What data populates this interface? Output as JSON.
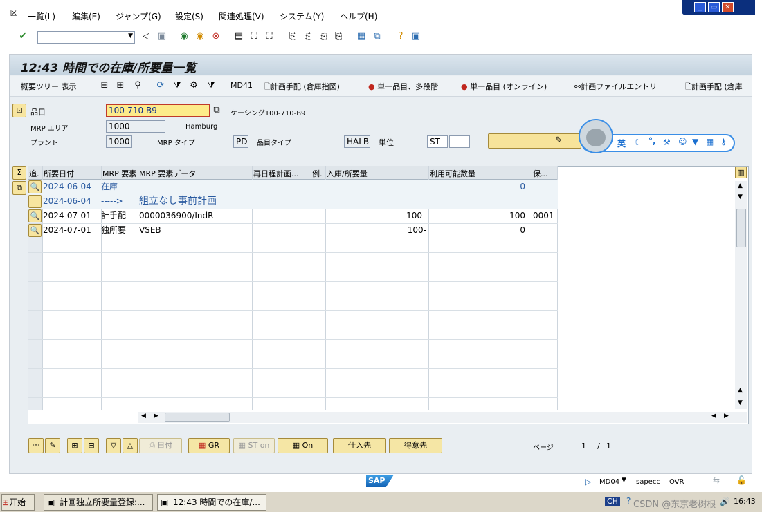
{
  "menu": {
    "items": [
      "一覧(L)",
      "編集(E)",
      "ジャンプ(G)",
      "設定(S)",
      "関連処理(V)",
      "システム(Y)",
      "ヘルプ(H)"
    ]
  },
  "window_controls": {
    "minimize": "_",
    "restore": "▭",
    "close": "✕"
  },
  "toolbar": {
    "command_value": ""
  },
  "screen": {
    "title": "12:43 時間での在庫/所要量一覧"
  },
  "app_toolbar": {
    "tree_toggle": "概要ツリー 表示",
    "md41": "MD41",
    "planned_order_wh": "計画手配 (倉庫指図)",
    "single_multi": "単一品目、多段階",
    "single_online": "単一品目 (オンライン)",
    "planning_file": "計画ファイルエントリ",
    "planned_order_2": "計画手配 (倉庫"
  },
  "header": {
    "material_label": "品目",
    "material_value": "100-710-B9",
    "material_desc": "ケーシング100-710-B9",
    "mrp_area_label": "MRP エリア",
    "mrp_area_value": "1000",
    "mrp_area_name": "Hamburg",
    "plant_label": "プラント",
    "plant_value": "1000",
    "mrp_type_label": "MRP タイプ",
    "mrp_type_value": "PD",
    "material_type_label": "品目タイプ",
    "material_type_value": "HALB",
    "unit_label": "単位",
    "unit_value": "ST"
  },
  "ime": {
    "lang": "英"
  },
  "table": {
    "columns": [
      "追.",
      "所要日付",
      "MRP 要素",
      "MRP 要素データ",
      "再日程計画...",
      "例.",
      "入庫/所要量",
      "利用可能数量",
      "保..."
    ],
    "rows": [
      {
        "date": "2024-06-04",
        "element": "在庫",
        "data": "",
        "receipt": "",
        "available": "0",
        "storage": "",
        "style": "blue"
      },
      {
        "date": "2024-06-04",
        "element": "----->",
        "data": "組立なし事前計画",
        "receipt": "",
        "available": "",
        "storage": "",
        "style": "blue"
      },
      {
        "date": "2024-07-01",
        "element": "計手配",
        "data": "0000036900/IndR",
        "receipt": "100",
        "available": "100",
        "storage": "0001",
        "style": "normal"
      },
      {
        "date": "2024-07-01",
        "element": "独所要",
        "data": "VSEB",
        "receipt": "100-",
        "available": "0",
        "storage": "",
        "style": "normal"
      }
    ]
  },
  "bottom_buttons": {
    "date": "日付",
    "gr": "GR",
    "st_on": "ST on",
    "on": "On",
    "vendor": "仕入先",
    "customer": "得意先",
    "page_label": "ページ",
    "page_current": "1",
    "page_sep": "/",
    "page_total": "1"
  },
  "status": {
    "sap_logo": "SAP",
    "transaction": "MD04",
    "server": "sapecc",
    "mode": "OVR"
  },
  "taskbar": {
    "start": "开始",
    "task1": "計画独立所要量登録:...",
    "task2": "12:43 時間での在庫/...",
    "input_lang": "CH",
    "time": "16:43",
    "watermark": "CSDN @东京老树根"
  }
}
